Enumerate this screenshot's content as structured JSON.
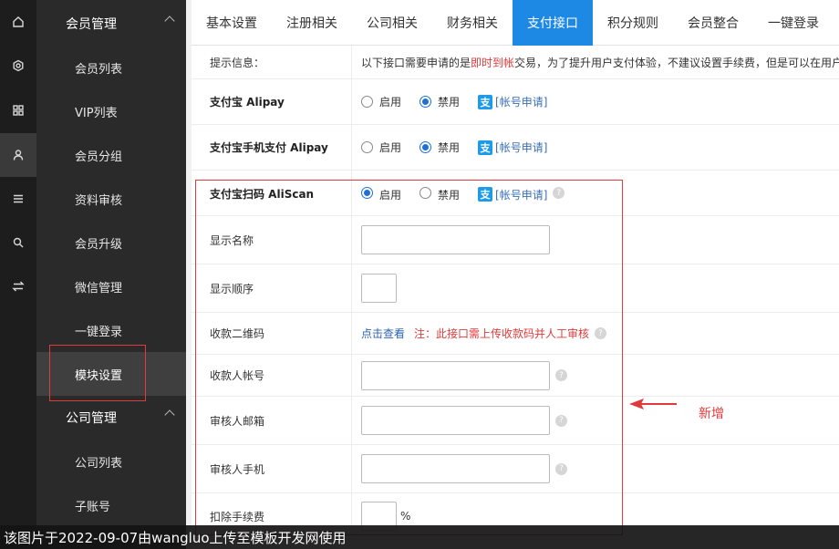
{
  "rail": {
    "icons": [
      "home-icon",
      "settings-icon",
      "grid-icon",
      "user-icon",
      "list-icon",
      "search-icon",
      "swap-icon"
    ],
    "active_index": 3
  },
  "sidebar": {
    "section1_title": "会员管理",
    "items": [
      "会员列表",
      "VIP列表",
      "会员分组",
      "资料审核",
      "会员升级",
      "微信管理",
      "一键登录",
      "模块设置"
    ],
    "active_item": "模块设置",
    "section2_title": "公司管理",
    "items2": [
      "公司列表",
      "子账号"
    ]
  },
  "tabs": [
    "基本设置",
    "注册相关",
    "公司相关",
    "财务相关",
    "支付接口",
    "积分规则",
    "会员整合",
    "一键登录"
  ],
  "active_tab": "支付接口",
  "form": {
    "tip_label": "提示信息：",
    "tip_prefix": "以下接口需要申请的是",
    "tip_highlight": "即时到帐",
    "tip_suffix": "交易，为了提升用户支付体验，不建议设置手续费，但是可以在用户",
    "enable_label": "启用",
    "disable_label": "禁用",
    "apply_link": "[帐号申请]",
    "rows": {
      "alipay": "支付宝 Alipay",
      "alipay_mobile": "支付宝手机支付 Alipay",
      "aliscan": "支付宝扫码 AliScan",
      "display_name": "显示名称",
      "display_order": "显示顺序",
      "qr_code": "收款二维码",
      "qr_view_link": "点击查看",
      "qr_note": "注：此接口需上传收款码并人工审核",
      "payee_account": "收款人帐号",
      "reviewer_email": "审核人邮箱",
      "reviewer_phone": "审核人手机",
      "fee": "扣除手续费",
      "fee_unit": "%"
    }
  },
  "annotation": {
    "label": "新增",
    "color": "#e03a3a"
  },
  "watermark": "该图片于2022-09-07由wangluo上传至模板开发网使用",
  "colors": {
    "accent": "#1e88e5",
    "sidebar_bg": "#2a2a2a",
    "rail_bg": "#1d1d1d"
  }
}
